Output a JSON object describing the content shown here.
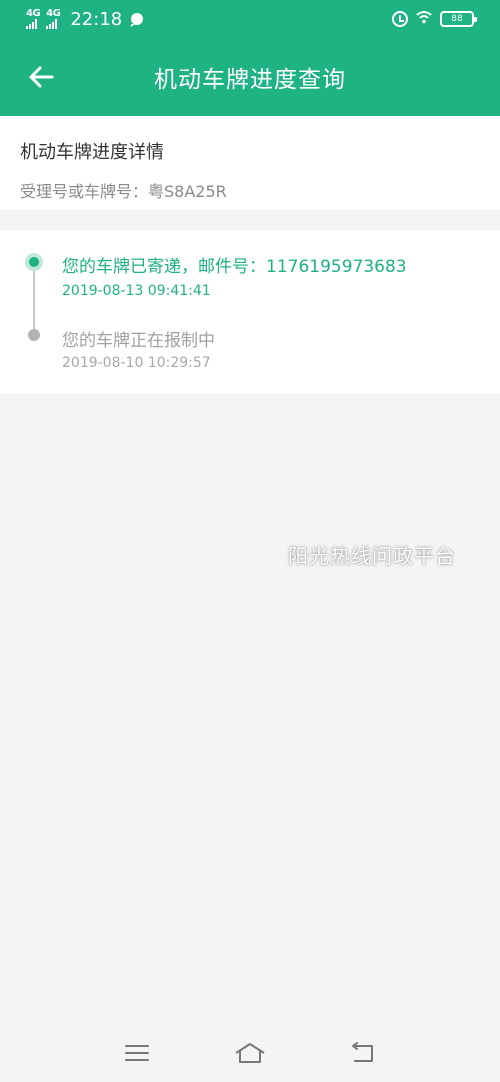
{
  "status_bar": {
    "signal_1": "4G",
    "signal_2": "4G",
    "time": "22:18",
    "battery": "88"
  },
  "header": {
    "title": "机动车牌进度查询",
    "back_icon": "arrow-left-icon",
    "background_color": "#1fb283"
  },
  "info": {
    "title": "机动车牌进度详情",
    "plate_label": "受理号或车牌号：",
    "plate_value": "粤S8A25R"
  },
  "timeline": [
    {
      "text": "您的车牌已寄递，邮件号：1176195973683",
      "time": "2019-08-13 09:41:41",
      "active": true
    },
    {
      "text": "您的车牌正在报制中",
      "time": "2019-08-10 10:29:57",
      "active": false
    }
  ],
  "watermark": "阳光热线问政平台",
  "nav": {
    "menu_icon": "menu-icon",
    "home_icon": "home-icon",
    "back_icon": "return-icon"
  }
}
